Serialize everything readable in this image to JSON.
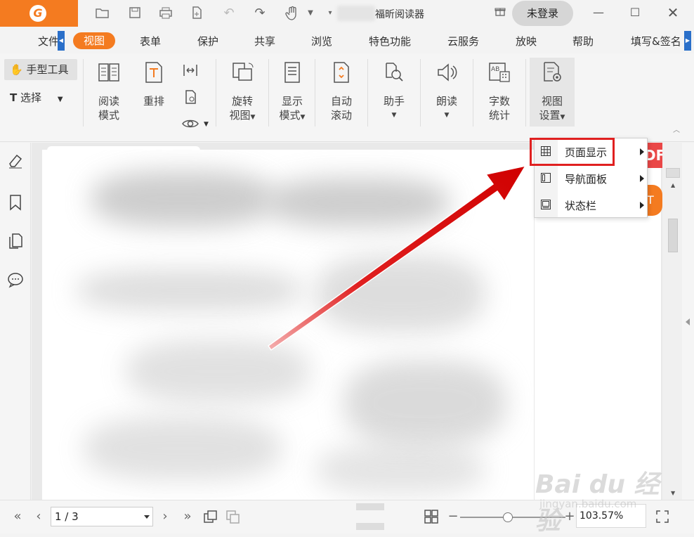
{
  "titlebar": {
    "app_title": "福昕阅读器",
    "login_label": "未登录",
    "quick_access": [
      "open-folder-icon",
      "save-icon",
      "print-icon",
      "new-file-icon",
      "undo-icon",
      "redo-icon",
      "hand-icon",
      "dropdown-icon",
      "customize-icon"
    ],
    "window_controls": [
      "minimize-icon",
      "maximize-icon",
      "close-icon"
    ]
  },
  "menu": {
    "items": [
      {
        "label": "文件",
        "active": false
      },
      {
        "label": "视图",
        "active": true
      },
      {
        "label": "表单",
        "active": false
      },
      {
        "label": "保护",
        "active": false
      },
      {
        "label": "共享",
        "active": false
      },
      {
        "label": "浏览",
        "active": false
      },
      {
        "label": "特色功能",
        "active": false
      },
      {
        "label": "云服务",
        "active": false
      },
      {
        "label": "放映",
        "active": false
      },
      {
        "label": "帮助",
        "active": false
      },
      {
        "label": "填写&签名",
        "active": false
      }
    ]
  },
  "ribbon": {
    "hand_tool": "手型工具",
    "select_tool": "选择",
    "buttons": [
      {
        "line1": "阅读",
        "line2": "模式",
        "icon": "read-mode-icon",
        "dropdown": false
      },
      {
        "line1": "重排",
        "line2": "",
        "icon": "reflow-icon",
        "dropdown": false
      },
      {
        "line1": "旋转",
        "line2": "视图",
        "icon": "rotate-view-icon",
        "dropdown": true
      },
      {
        "line1": "显示",
        "line2": "模式",
        "icon": "display-mode-icon",
        "dropdown": true
      },
      {
        "line1": "自动",
        "line2": "滚动",
        "icon": "auto-scroll-icon",
        "dropdown": false
      },
      {
        "line1": "助手",
        "line2": "",
        "icon": "assistant-icon",
        "dropdown": true
      },
      {
        "line1": "朗读",
        "line2": "",
        "icon": "read-aloud-icon",
        "dropdown": true
      },
      {
        "line1": "字数",
        "line2": "统计",
        "icon": "word-count-icon",
        "dropdown": false
      },
      {
        "line1": "视图",
        "line2": "设置",
        "icon": "view-settings-icon",
        "dropdown": true,
        "active": true
      }
    ]
  },
  "dropdown_menu": {
    "items": [
      {
        "label": "页面显示",
        "icon": "page-display-icon",
        "highlighted": true
      },
      {
        "label": "导航面板",
        "icon": "nav-panel-icon",
        "highlighted": false
      },
      {
        "label": "状态栏",
        "icon": "status-bar-icon",
        "highlighted": false
      }
    ]
  },
  "document": {
    "badge_text": "DF",
    "side_tab_text": "T"
  },
  "statusbar": {
    "page_value": "1 / 3",
    "zoom_value": "103.57%",
    "zoom_level": 0.45
  },
  "watermark": {
    "brand": "Bai du 经验",
    "sub": "jingyan.baidu.com"
  },
  "colors": {
    "accent": "#f47b20",
    "highlight": "#e02020",
    "arrow": "#e01010"
  }
}
